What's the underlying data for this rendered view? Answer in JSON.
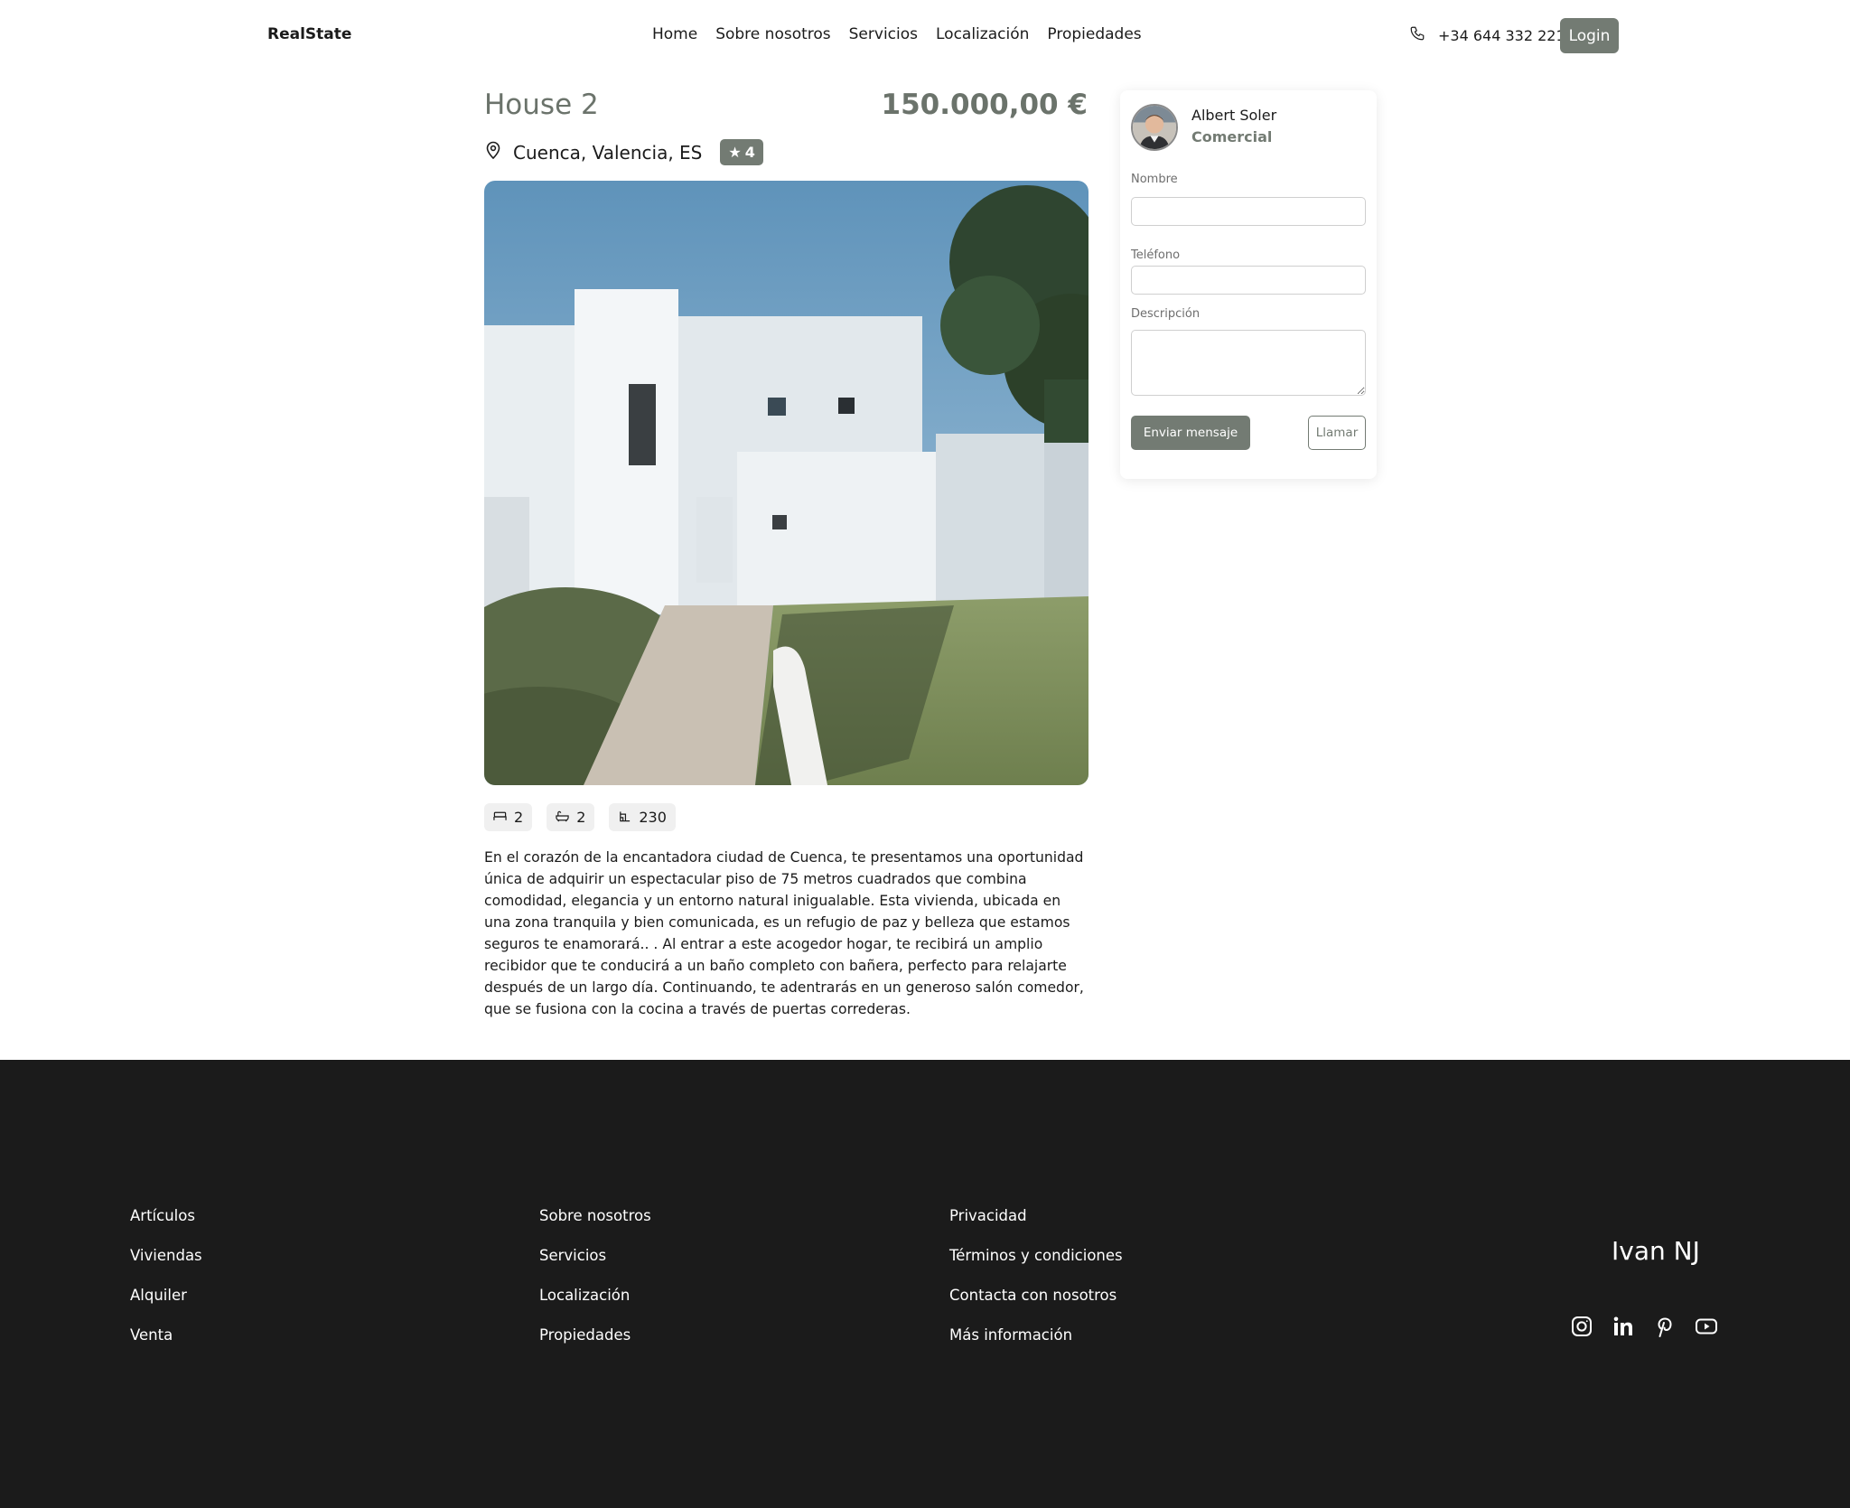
{
  "header": {
    "brand": "RealState",
    "nav": [
      "Home",
      "Sobre nosotros",
      "Servicios",
      "Localización",
      "Propiedades"
    ],
    "phone": "+34 644 332 221",
    "login_label": "Login"
  },
  "listing": {
    "title": "House 2",
    "price": "150.000,00 €",
    "location": "Cuenca, Valencia, ES",
    "rating": "4",
    "features": {
      "bedrooms": "2",
      "bathrooms": "2",
      "area": "230"
    },
    "description": "En el corazón de la encantadora ciudad de Cuenca, te presentamos una oportunidad única de adquirir un espectacular piso de 75 metros cuadrados que combina comodidad, elegancia y un entorno natural inigualable. Esta vivienda, ubicada en una zona tranquila y bien comunicada, es un refugio de paz y belleza que estamos seguros te enamorará.. . Al entrar a este acogedor hogar, te recibirá un amplio recibidor que te conducirá a un baño completo con bañera, perfecto para relajarte después de un largo día. Continuando, te adentrarás en un generoso salón comedor, que se fusiona con la cocina a través de puertas correderas."
  },
  "contact": {
    "agent_name": "Albert Soler",
    "agent_role": "Comercial",
    "name_label": "Nombre",
    "phone_label": "Teléfono",
    "description_label": "Descripción",
    "send_label": "Enviar mensaje",
    "call_label": "Llamar"
  },
  "footer": {
    "col1": [
      "Artículos",
      "Viviendas",
      "Alquiler",
      "Venta"
    ],
    "col2": [
      "Sobre nosotros",
      "Servicios",
      "Localización",
      "Propiedades"
    ],
    "col3": [
      "Privacidad",
      "Términos y condiciones",
      "Contacta con nosotros",
      "Más información"
    ],
    "brand": "Ivan NJ",
    "socials": [
      "instagram-icon",
      "linkedin-icon",
      "pinterest-icon",
      "youtube-icon"
    ]
  },
  "colors": {
    "accent": "#737b73",
    "footer_bg": "#1b1b1b",
    "text": "#1b1b1b"
  }
}
